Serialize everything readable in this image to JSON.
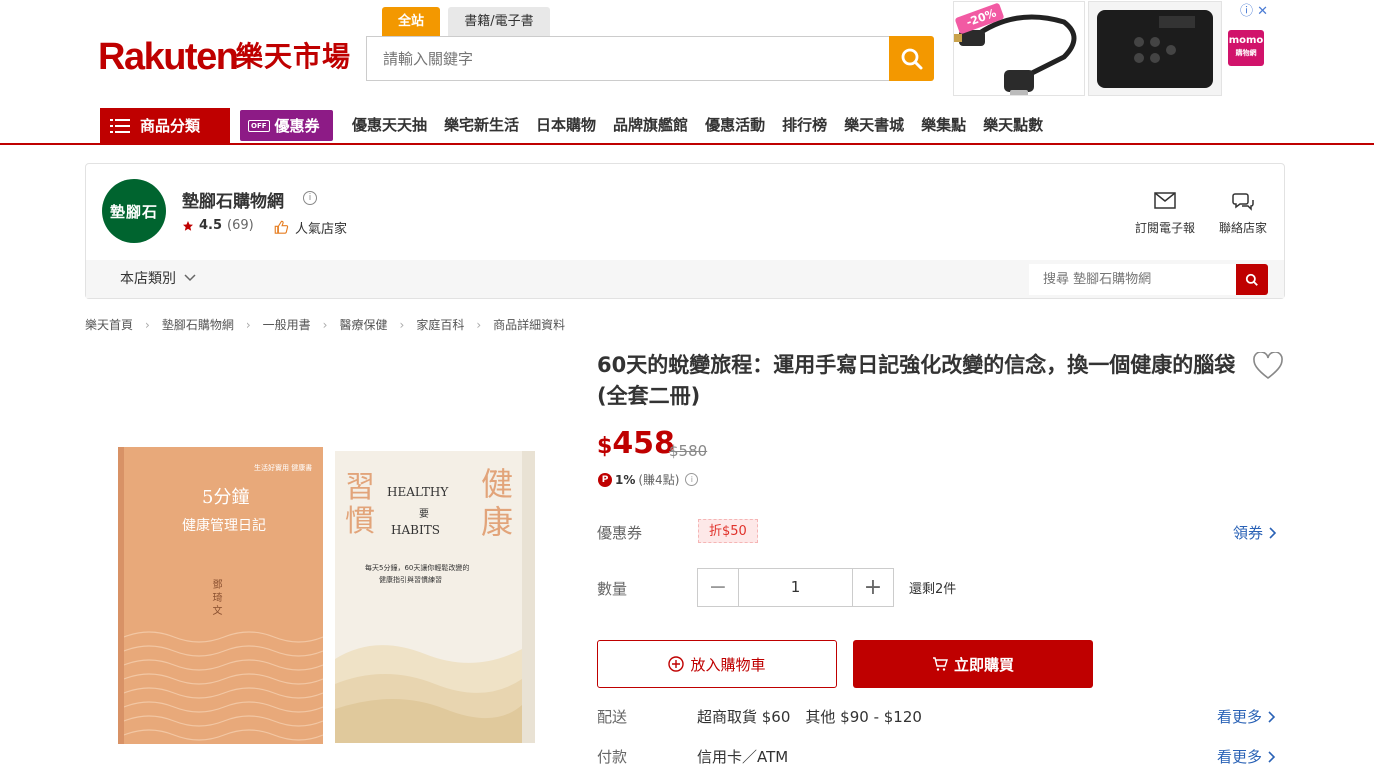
{
  "header": {
    "logo_en": "Rakuten",
    "logo_cn": "樂天市場",
    "scope_tabs": [
      "全站",
      "書籍/電子書"
    ],
    "search_placeholder": "請輸入關鍵字"
  },
  "ads": {
    "discount": "-20%",
    "brand_badge": "momo",
    "brand_sub": "購物網",
    "info": "ⓘ ✕"
  },
  "nav": {
    "category_label": "商品分類",
    "coupon_label": "優惠券",
    "coupon_tag": "OFF",
    "links": [
      "優惠天天抽",
      "樂宅新生活",
      "日本購物",
      "品牌旗艦館",
      "優惠活動",
      "排行榜",
      "樂天書城",
      "樂集點",
      "樂天點數"
    ]
  },
  "store": {
    "logo_text": "墊腳石",
    "name": "墊腳石購物網",
    "rating": "4.5",
    "review_count": "(69)",
    "popular_label": "人氣店家",
    "subscribe_label": "訂閱電子報",
    "contact_label": "聯絡店家",
    "category_label": "本店類別",
    "search_placeholder": "搜尋 墊腳石購物網"
  },
  "breadcrumb": [
    "樂天首頁",
    "墊腳石購物網",
    "一般用書",
    "醫療保健",
    "家庭百科",
    "商品詳細資料"
  ],
  "book1": {
    "title_line1": "5分鐘",
    "title_line2": "健康管理日記",
    "author": "鄧 琦 文",
    "top_label": "生活好實用 健康書"
  },
  "book2": {
    "cn1": "習",
    "cn2": "慣",
    "cn3": "健",
    "cn4": "康",
    "en1": "HEALTHY",
    "mid": "要",
    "en2": "HABITS",
    "subtitle": "每天5分鐘，60天讓你輕鬆改變的",
    "subtitle2": "健康指引與習慣練習"
  },
  "product": {
    "title": "60天的蛻變旅程：運用手寫日記強化改變的信念，換一個健康的腦袋(全套二冊)",
    "currency": "$",
    "price": "458",
    "original_price": "$580",
    "points_badge": "P",
    "points_pct": "1%",
    "points_note": "(賺4點)",
    "coupon_label": "優惠券",
    "coupon_value": "折$50",
    "coupon_link": "領券",
    "qty_label": "數量",
    "qty_value": "1",
    "qty_minus": "−",
    "qty_plus": "+",
    "stock_text": "還剩2件",
    "add_cart": "放入購物車",
    "buy_now": "立即購買",
    "shipping_label": "配送",
    "shipping_value": "超商取貨 $60　其他 $90 - $120",
    "shipping_more": "看更多",
    "payment_label": "付款",
    "payment_value": "信用卡／ATM",
    "payment_more": "看更多"
  },
  "colors": {
    "brand_red": "#bf0000",
    "search_orange": "#f39800",
    "coupon_purple": "#8d1b86",
    "link_blue": "#2a62b6",
    "store_green": "#00642f"
  }
}
